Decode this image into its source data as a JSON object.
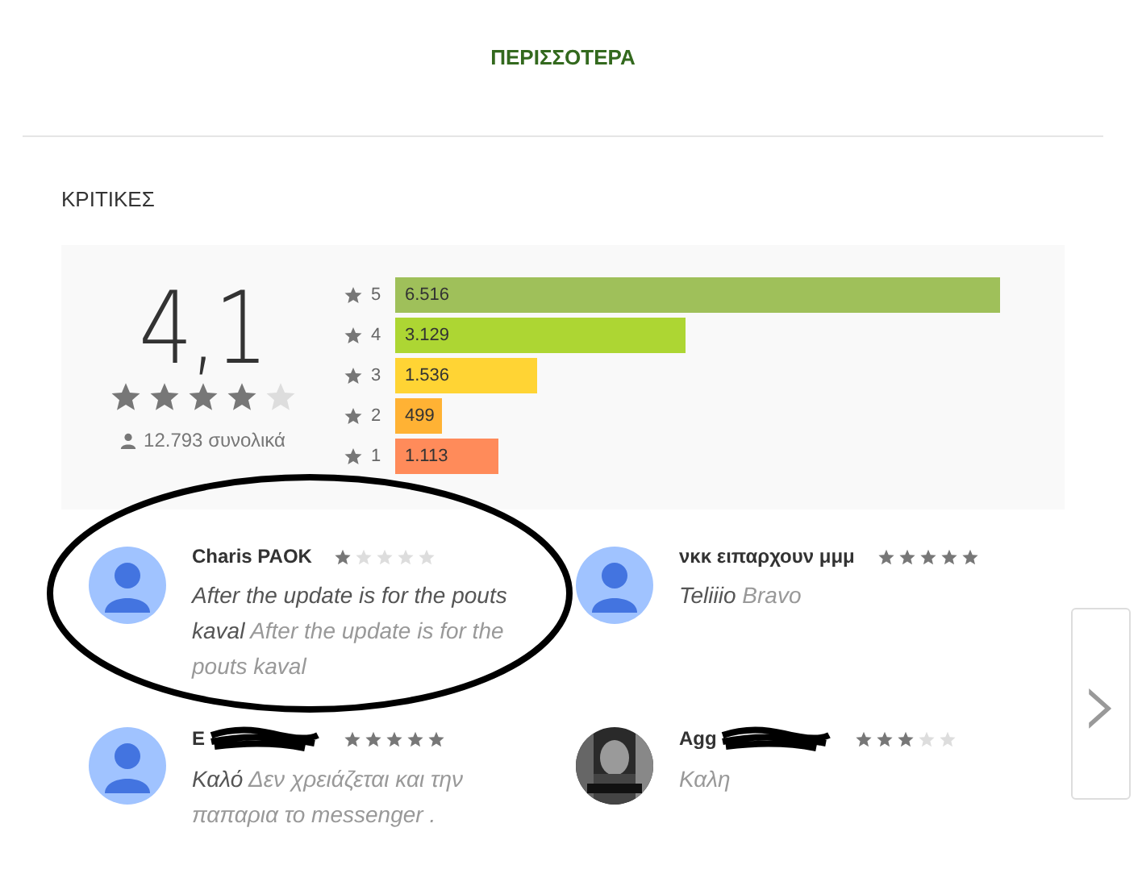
{
  "header": {
    "more_link": "ΠΕΡΙΣΣΟΤΕΡΑ"
  },
  "reviews_section": {
    "heading": "ΚΡΙΤΙΚΕΣ",
    "summary": {
      "score": "4,1",
      "stars": 4,
      "total": "12.793 συνολικά"
    },
    "histogram": {
      "bars": [
        {
          "color": "#9fc05a"
        },
        {
          "color": "#add633"
        },
        {
          "color": "#ffd434"
        },
        {
          "color": "#ffb234"
        },
        {
          "color": "#ff8b5a"
        }
      ],
      "chart_data": {
        "type": "bar",
        "orientation": "horizontal",
        "categories": [
          "5",
          "4",
          "3",
          "2",
          "1"
        ],
        "values": [
          6516,
          3129,
          1536,
          499,
          1113
        ],
        "value_labels": [
          "6.516",
          "3.129",
          "1.536",
          "499",
          "1.113"
        ],
        "xlim": [
          0,
          6516
        ]
      }
    }
  },
  "reviews": [
    {
      "author": "Charis PAOK",
      "stars": 1,
      "title": "After the update is for the pouts kaval",
      "body": "After the update is for the pouts kaval",
      "kind": "default",
      "annotated": true,
      "redacted": false
    },
    {
      "author": "νκκ ειπαρχουν μμμ",
      "stars": 5,
      "title": "Teliiio",
      "body": "Bravo",
      "kind": "default",
      "annotated": false,
      "redacted": false
    },
    {
      "author": "Ε",
      "stars": 5,
      "title": "Καλό",
      "body": "Δεν χρειάζεται και την παπαρια το messenger .",
      "kind": "default",
      "annotated": false,
      "redacted": true
    },
    {
      "author": "Agg",
      "stars": 3,
      "body": "Καλη",
      "kind": "picture",
      "annotated": false,
      "redacted": true
    }
  ],
  "next_button": {
    "symbol": "›"
  }
}
